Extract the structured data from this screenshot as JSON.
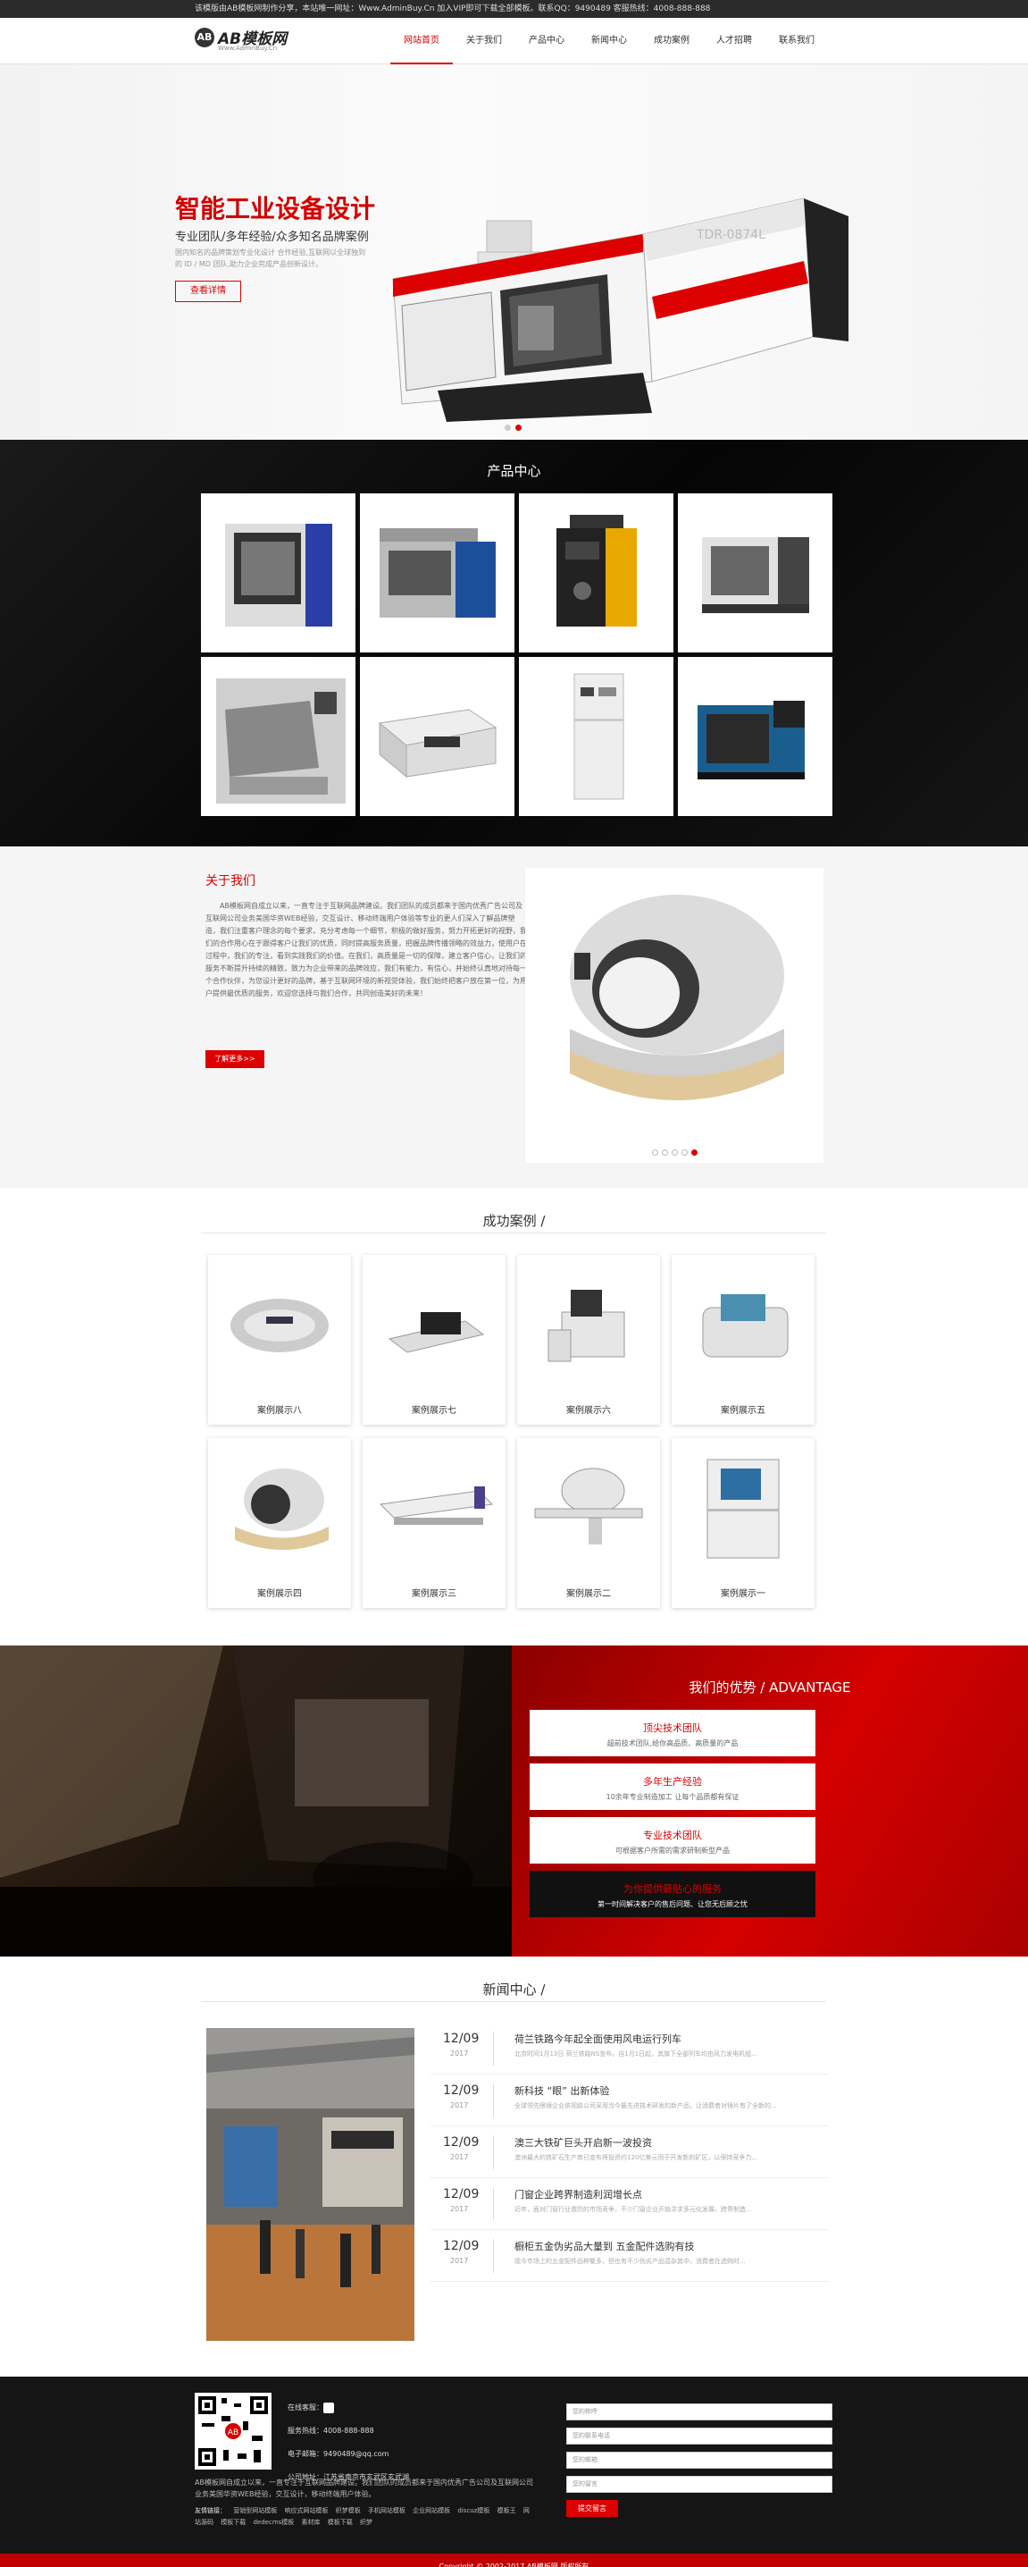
{
  "topbar": {
    "text": "该模版由AB模板网制作分享，本站唯一网址：Www.AdminBuy.Cn 加入VIP即可下载全部模板。联系QQ：9490489  客服热线：4008-888-888"
  },
  "logo": {
    "mark": "AB",
    "name": "AB模板网",
    "sub": "Www.AdminBuy.Cn"
  },
  "nav": [
    {
      "label": "网站首页",
      "active": true
    },
    {
      "label": "关于我们"
    },
    {
      "label": "产品中心"
    },
    {
      "label": "新闻中心"
    },
    {
      "label": "成功案例"
    },
    {
      "label": "人才招聘"
    },
    {
      "label": "联系我们"
    }
  ],
  "hero": {
    "title": "智能工业设备设计",
    "subtitle": "专业团队/多年经验/众多知名品牌案例",
    "desc": "国内知名的品牌策划专业化设计 合作经验,互联网以全球独到的 ID / MD 团队,助力企业完成产品创新设计。",
    "button": "查看详情",
    "machine_label": "TDR-0874L"
  },
  "products": {
    "title": "产品中心"
  },
  "about": {
    "title": "关于我们",
    "text": "AB模板网自成立以来，一直专注于互联网品牌建设。我们团队的成员都来于国内优秀广告公司及互联网公司业务美国华资WEB经验，交互设计、移动终端用户体验等专业的更人们深入了解品牌塑造，我们注重客户理念的每个要求，充分考虑每一个细节，积极的做好服务，努力开拓更好的视野，我们的合作用心在于跟得客户让我们的优质，同时提高服务质量，把握品牌传播领略的效益力，使用户在过程中，我们的专注，看到实践我们的价值。在我们，高质量是一切的保障，建立客户信心，让我们的服务不断提升持续的精致，致力为企业带来的品牌效应，我们有能力，有信心，并始终认真地对待每一个合作伙伴，为您设计更好的品牌，基于互联网环境的新视觉体验，我们始终把客户放在第一位，为用户提供最优质的服务，欢迎您选择与我们合作，共同创造美好的未来！",
    "button": "了解更多>>"
  },
  "cases": {
    "title": "成功案例 /",
    "items": [
      "案例展示八",
      "案例展示七",
      "案例展示六",
      "案例展示五",
      "案例展示四",
      "案例展示三",
      "案例展示二",
      "案例展示一"
    ]
  },
  "advantage": {
    "title": "我们的优势 / ADVANTAGE",
    "items": [
      {
        "title": "顶尖技术团队",
        "sub": "超前技术团队,给你高品质、高质量的产品"
      },
      {
        "title": "多年生产经验",
        "sub": "10余年专业制造加工 让每个品质都有保证"
      },
      {
        "title": "专业技术团队",
        "sub": "可根据客户所需的需求研制新型产品"
      },
      {
        "title": "为你提供最贴心的服务",
        "sub": "第一时间解决客户的售后问题、让您无后顾之忧"
      }
    ]
  },
  "news": {
    "title": "新闻中心 /",
    "items": [
      {
        "md": "12/09",
        "yr": "2017",
        "title": "荷兰铁路今年起全面使用风电运行列车",
        "sub": "北京时间1月13日 荷兰铁路NS宣布，自1月1日起，其旗下全部列车均由风力发电机组..."
      },
      {
        "md": "12/09",
        "yr": "2017",
        "title": "新科技 “眼” 出新体验",
        "sub": "全球领先眼镜企业依视路公司采用当今最先进技术研发的新产品，让消费者对镜片有了全新的..."
      },
      {
        "md": "12/09",
        "yr": "2017",
        "title": "澳三大铁矿巨头开启新一波投资",
        "sub": "澳洲最大的铁矿石生产商已宣布将投资约120亿美元用于开发新的矿区，以保持竞争力..."
      },
      {
        "md": "12/09",
        "yr": "2017",
        "title": "门窗企业跨界制造利润增长点",
        "sub": "近年，面对门窗行业激烈的市场竞争，不少门窗企业开始寻求多元化发展，跨界制造..."
      },
      {
        "md": "12/09",
        "yr": "2017",
        "title": "橱柜五金伪劣品大量到 五金配件选购有技",
        "sub": "现今市场上的五金配件品种繁多，但也有不少伪劣产品混杂其中，消费者在选购时..."
      }
    ]
  },
  "footer": {
    "online_label": "在线客服：",
    "phone": "服务热线：4008-888-888",
    "email": "电子邮箱：9490489@qq.com",
    "address": "公司地址：江苏省南京市玄武区玄武湖",
    "desc": "AB模板网自成立以来，一直专注于互联网品牌建设。我们团队的成员都来于国内优秀广告公司及互联网公司业务美国华资WEB经验，交互设计，移动终端用户体验。",
    "links_label": "友情链接：",
    "links": [
      "营销型网站模板",
      "响应式网站模板",
      "织梦模板",
      "手机网站模板",
      "企业网站模板",
      "discuz模板",
      "模板王",
      "网站源码",
      "模板下载",
      "dedecms模板",
      "素材库",
      "模板下载",
      "织梦"
    ],
    "form": {
      "name": "您的称呼",
      "phone": "您的联系电话",
      "email": "您的邮箱",
      "msg": "您的留言",
      "submit": "提交留言"
    },
    "copyright": "Copyright © 2002-2017 AB模板网 版权所有"
  }
}
